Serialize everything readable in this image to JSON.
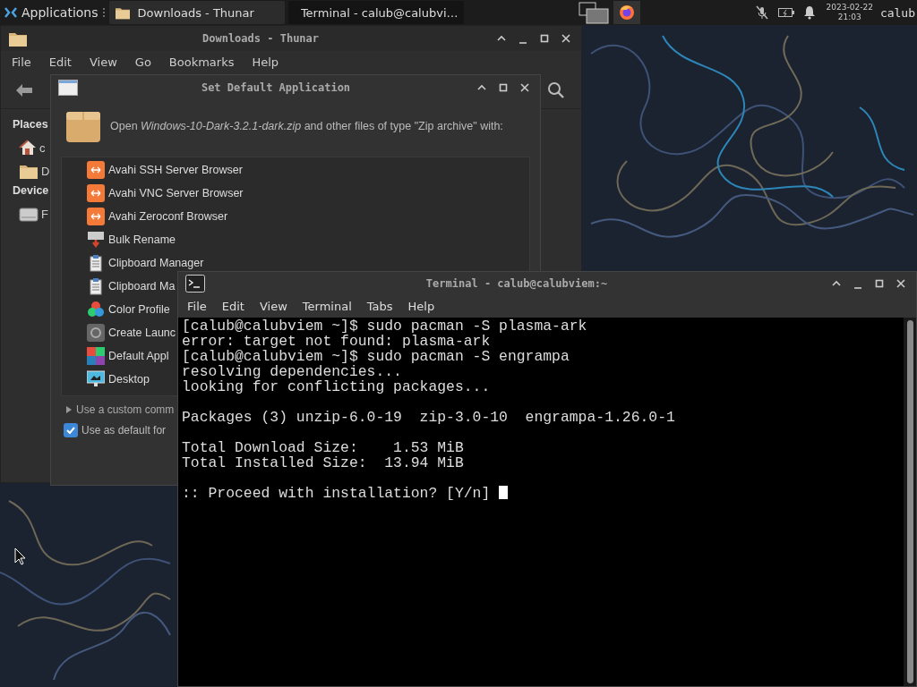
{
  "panel": {
    "applications_label": "Applications",
    "tasks": [
      {
        "label": "Downloads - Thunar",
        "kind": "folder",
        "selected": false
      },
      {
        "label": "Terminal - calub@calubvi…",
        "kind": "terminal",
        "selected": true
      }
    ],
    "clock": {
      "date": "2023-02-22",
      "time": "21:03"
    },
    "user": "calub"
  },
  "file_manager": {
    "title": "Downloads - Thunar",
    "menu": [
      "File",
      "Edit",
      "View",
      "Go",
      "Bookmarks",
      "Help"
    ],
    "sidebar": [
      {
        "kind": "heading",
        "label": "Places"
      },
      {
        "kind": "home",
        "label": "c"
      },
      {
        "kind": "folder",
        "label": "D"
      },
      {
        "kind": "heading",
        "label": "Device"
      },
      {
        "kind": "drive",
        "label": "F"
      }
    ]
  },
  "dialog": {
    "title": "Set Default Application",
    "prompt": "Open *Windows-10-Dark-3.2.1-dark.zip* and other files of type \"Zip archive\" with:",
    "apps": [
      {
        "label": "Avahi SSH Server Browser",
        "kind": "avahi"
      },
      {
        "label": "Avahi VNC Server Browser",
        "kind": "avahi"
      },
      {
        "label": "Avahi Zeroconf Browser",
        "kind": "avahi"
      },
      {
        "label": "Bulk Rename",
        "kind": "rename"
      },
      {
        "label": "Clipboard Manager",
        "kind": "clipboard"
      },
      {
        "label": "Clipboard Ma",
        "kind": "clipboard"
      },
      {
        "label": "Color Profile",
        "kind": "color"
      },
      {
        "label": "Create Launc",
        "kind": "launcher"
      },
      {
        "label": "Default Appl",
        "kind": "default"
      },
      {
        "label": "Desktop",
        "kind": "desktop"
      }
    ],
    "custom_command": {
      "label": "Use a custom comm",
      "expanded": false
    },
    "default_checkbox": {
      "label": "Use as default for",
      "checked": true
    }
  },
  "terminal": {
    "title": "Terminal - calub@calubviem:~",
    "menu": [
      "File",
      "Edit",
      "View",
      "Terminal",
      "Tabs",
      "Help"
    ],
    "blocks": [
      [
        "[calub@calubviem ~]$ sudo pacman -S plasma-ark",
        "error: target not found: plasma-ark",
        "[calub@calubviem ~]$ sudo pacman -S engrampa",
        "resolving dependencies...",
        "looking for conflicting packages..."
      ],
      [
        "Packages (3) unzip-6.0-19  zip-3.0-10  engrampa-1.26.0-1"
      ],
      [
        "Total Download Size:    1.53 MiB",
        "Total Installed Size:  13.94 MiB"
      ],
      [
        ":: Proceed with installation? [Y/n] "
      ]
    ]
  }
}
